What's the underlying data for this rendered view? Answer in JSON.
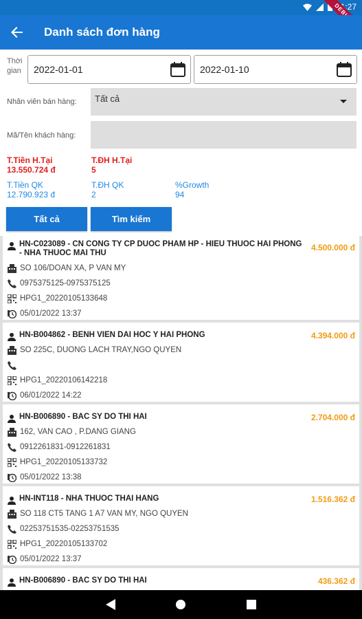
{
  "status": {
    "time": "11:27",
    "debug_banner": "DEBUG"
  },
  "appbar": {
    "title": "Danh sách đơn hàng",
    "back_icon": "arrow-back-icon"
  },
  "filters": {
    "time_label": "Thời gian",
    "date_from": "2022-01-01",
    "date_to": "2022-01-10",
    "staff_label": "Nhân viên bán hàng:",
    "staff_value": "Tất cả",
    "customer_label": "Mã/Tên khách hàng:",
    "customer_value": ""
  },
  "stats": {
    "current_amount_label": "T.Tiền H.Tại",
    "current_amount_value": "13.550.724 đ",
    "current_orders_label": "T.ĐH H.Tại",
    "current_orders_value": "5",
    "past_amount_label": "T.Tiền QK",
    "past_amount_value": "12.790.923 đ",
    "past_orders_label": "T.ĐH QK",
    "past_orders_value": "2",
    "growth_label": "%Growth",
    "growth_value": "94"
  },
  "buttons": {
    "all": "Tất cả",
    "search": "Tìm kiếm"
  },
  "colors": {
    "primary": "#1976d2",
    "amount": "#f39c12",
    "red": "#e02020",
    "blue": "#1e88e5"
  },
  "orders": [
    {
      "title": "HN-C023089 - CN CONG TY CP DUOC PHAM HP - HIEU THUOC HAI PHONG - NHA THUOC MAI THU",
      "amount": "4.500.000 đ",
      "address": "SO 106/DOAN XA, P VAN MY",
      "phone": "0975375125-0975375125",
      "code": "HPG1_20220105133648",
      "time": "05/01/2022 13:37"
    },
    {
      "title": "HN-B004862 - BENH VIEN DAI HOC Y HAI PHONG",
      "amount": "4.394.000 đ",
      "address": "SO 225C, DUONG LACH TRAY,NGO QUYEN",
      "phone": "",
      "code": "HPG1_20220106142218",
      "time": "06/01/2022 14:22"
    },
    {
      "title": "HN-B006890 - BAC SY DO THI HAI",
      "amount": "2.704.000 đ",
      "address": "162, VAN CAO , P.DANG GIANG",
      "phone": "0912261831-0912261831",
      "code": "HPG1_20220105133732",
      "time": "05/01/2022 13:38"
    },
    {
      "title": "HN-INT118 - NHA THUOC THAI HANG",
      "amount": "1.516.362 đ",
      "address": "SO 118 CT5 TANG 1 A7 VAN MY, NGO QUYEN",
      "phone": "02253751535-02253751535",
      "code": "HPG1_20220105133702",
      "time": "05/01/2022 13:37"
    },
    {
      "title": "HN-B006890 - BAC SY DO THI HAI",
      "amount": "436.362 đ"
    }
  ]
}
